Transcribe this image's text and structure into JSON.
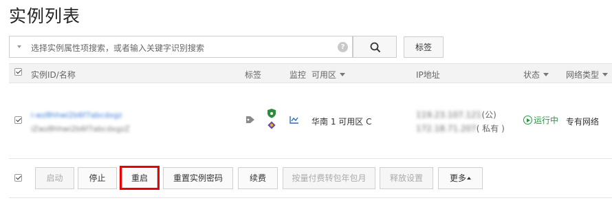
{
  "page": {
    "title": "实例列表"
  },
  "search": {
    "placeholder": "选择实例属性项搜索，或者输入关键字识别搜索",
    "help_glyph": "?"
  },
  "toolbar": {
    "tag_label": "标签"
  },
  "table": {
    "columns": {
      "id_name": "实例ID/名称",
      "tags": "标签",
      "monitor": "监控",
      "zone": "可用区",
      "ip": "IP地址",
      "status": "状态",
      "network": "网络类型"
    },
    "rows": [
      {
        "checked": true,
        "instance_id": "i-wz8hhwi2b6f7abcdxgz",
        "instance_name": "iZwz8hhwi2b6f7abcdxgzZ",
        "zone": "华南 1 可用区 C",
        "public_ip": "119.23.107.121",
        "public_ip_suffix": "(公)",
        "private_ip": "172.18.71.207",
        "private_ip_suffix": "( 私有 )",
        "status": "运行中",
        "status_color": "#1e9e3a",
        "network_type": "专有网络",
        "icons": [
          "tag-icon",
          "shield-icon",
          "cloud-assistant-icon",
          "monitor-chart-icon"
        ]
      }
    ]
  },
  "actions": {
    "start": "启动",
    "stop": "停止",
    "restart": "重启",
    "reset_password": "重置实例密码",
    "renew": "续费",
    "convert_billing": "按量付费转包年包月",
    "release_settings": "释放设置",
    "more": "更多"
  },
  "colors": {
    "highlight": "#e00000",
    "link": "#3a7bd5",
    "running": "#1e9e3a"
  }
}
